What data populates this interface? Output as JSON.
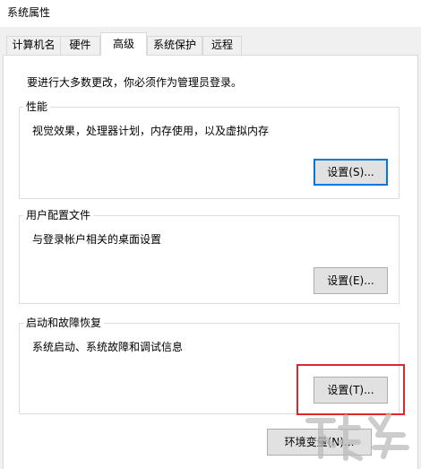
{
  "window": {
    "title": "系统属性"
  },
  "tabs": [
    {
      "label": "计算机名"
    },
    {
      "label": "硬件"
    },
    {
      "label": "高级"
    },
    {
      "label": "系统保护"
    },
    {
      "label": "远程"
    }
  ],
  "admin_note": "要进行大多数更改，你必须作为管理员登录。",
  "performance": {
    "title": "性能",
    "description": "视觉效果，处理器计划，内存使用，以及虚拟内存",
    "button": "设置(S)..."
  },
  "user_profiles": {
    "title": "用户配置文件",
    "description": "与登录帐户相关的桌面设置",
    "button": "设置(E)..."
  },
  "startup_recovery": {
    "title": "启动和故障恢复",
    "description": "系统启动、系统故障和调试信息",
    "button": "设置(T)..."
  },
  "env_button": "环境变量(N)...",
  "colors": {
    "highlight_box": "#e0282b",
    "focus_ring": "#0078d7"
  }
}
